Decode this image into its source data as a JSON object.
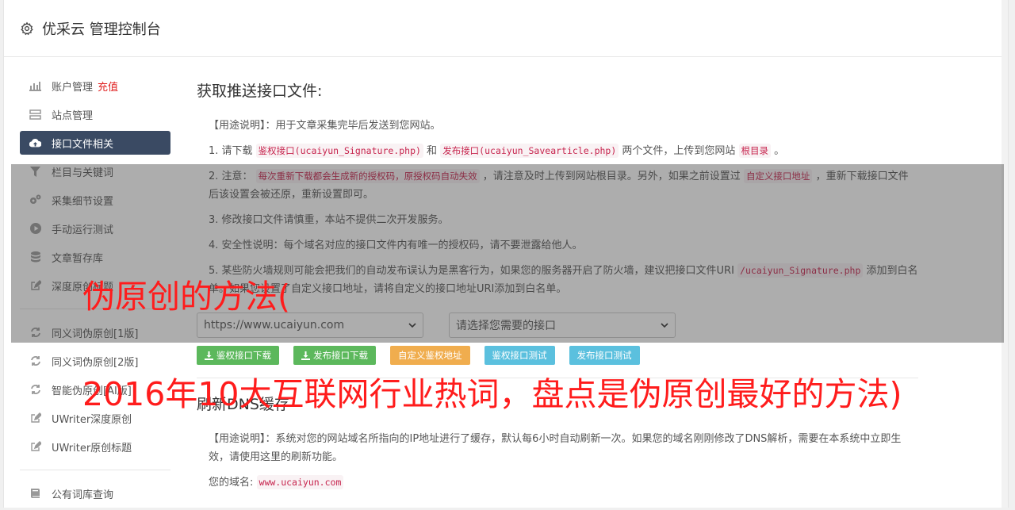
{
  "header": {
    "title": "优采云 管理控制台"
  },
  "sidebar": {
    "items": [
      {
        "label": "账户管理",
        "badge": "充值",
        "icon": "bar-chart-icon"
      },
      {
        "label": "站点管理",
        "icon": "server-icon"
      },
      {
        "label": "接口文件相关",
        "icon": "cloud-upload-icon",
        "active": true
      },
      {
        "label": "栏目与关键词",
        "icon": "filter-icon"
      },
      {
        "label": "采集细节设置",
        "icon": "cogs-icon"
      },
      {
        "label": "手动运行测试",
        "icon": "play-circle-icon"
      },
      {
        "label": "文章暂存库",
        "icon": "database-icon"
      },
      {
        "label": "深度原创标题",
        "icon": "edit-icon"
      }
    ],
    "items2": [
      {
        "label": "同义词伪原创[1版]",
        "icon": "refresh-icon"
      },
      {
        "label": "同义词伪原创[2版]",
        "icon": "refresh-icon"
      },
      {
        "label": "智能伪原创[AI版]",
        "icon": "refresh-icon"
      },
      {
        "label": "UWriter深度原创",
        "icon": "edit-icon"
      },
      {
        "label": "UWriter原创标题",
        "icon": "edit-icon"
      }
    ],
    "items3": [
      {
        "label": "公有词库查询",
        "icon": "book-icon"
      }
    ]
  },
  "section1": {
    "title": "获取推送接口文件:",
    "usage": "【用途说明】：用于文章采集完毕后发送到您网站。",
    "s1": {
      "a": "1. 请下载 ",
      "c1": "鉴权接口(ucaiyun_Signature.php)",
      "b": " 和 ",
      "c2": "发布接口(ucaiyun_Savearticle.php)",
      "d": " 两个文件，上传到您网站 ",
      "c3": "根目录",
      "e": " 。"
    },
    "s2": {
      "a": "2. 注意： ",
      "c1": "每次重新下载都会生成新的授权码，原授权码自动失效",
      "b": " ，请注意及时上传到网站根目录。另外，如果之前设置过 ",
      "c2": "自定义接口地址",
      "d": " ，重新下载接口文件后该设置会被还原，重新设置即可。"
    },
    "s3": "3. 修改接口文件请慎重，本站不提供二次开发服务。",
    "s4": "4. 安全性说明：每个域名对应的接口文件内有唯一的授权码，请不要泄露给他人。",
    "s5": {
      "a": "5. 某些防火墙规则可能会把我们的自动发布误认为是黑客行为，如果您的服务器开启了防火墙，建议把接口文件URI ",
      "c1": "/ucaiyun_Signature.php",
      "b": " 添加到白名单。如果您设置了自定义接口地址，请将自定义的接口地址URI添加到白名单。"
    },
    "select_site": "https://www.ucaiyun.com",
    "select_api": "请选择您需要的接口",
    "buttons": {
      "auth_download": "鉴权接口下载",
      "publish_download": "发布接口下载",
      "custom_auth": "自定义鉴权地址",
      "auth_test": "鉴权接口测试",
      "publish_test": "发布接口测试"
    }
  },
  "section2": {
    "title": "刷新DNS缓存",
    "usage": "【用途说明】：系统对您的网站域名所指向的IP地址进行了缓存，默认每6小时自动刷新一次。如果您的域名刚刚修改了DNS解析，需要在本系统中立即生效，请使用这里的刷新功能。",
    "domain_label": "您的域名: ",
    "domain_value": "www.ucaiyun.com"
  },
  "watermark": {
    "line1": "伪原创的方法(",
    "line2": "2016年10大互联网行业热词，盘点是伪原创最好的方法)"
  }
}
